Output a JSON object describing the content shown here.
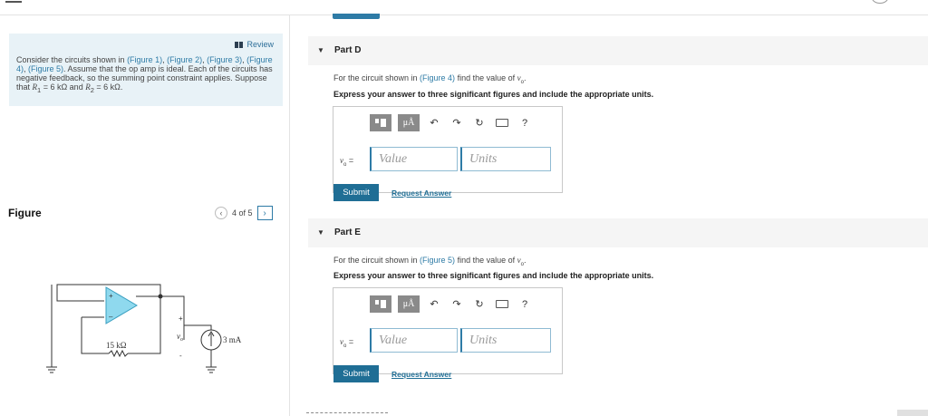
{
  "review_label": "Review",
  "intro": {
    "t1": "Consider the circuits shown in ",
    "f1": "(Figure 1)",
    "t2": ", ",
    "f2": "(Figure 2)",
    "t3": ", ",
    "f3": "(Figure 3)",
    "t4": ", ",
    "f4": "(Figure 4)",
    "t5": ", ",
    "f5": "(Figure 5)",
    "t6": ". Assume that the op amp is ideal. Each of the circuits has negative feedback, so the summing point constraint applies. Suppose that ",
    "r1": "R",
    "r1_sub": "1",
    "t7": " = 6 kΩ and ",
    "r2": "R",
    "r2_sub": "2",
    "t8": " = 6 kΩ."
  },
  "figure": {
    "label": "Figure",
    "pager_text": "4 of 5",
    "prev_glyph": "‹",
    "next_glyph": "›",
    "resistor_label": "15 kΩ",
    "vo_label": "v",
    "vo_sub": "o",
    "plus": "+",
    "minus": "-",
    "current_label": "3 mA",
    "opamp_plus": "+",
    "opamp_minus": "–"
  },
  "parts": [
    {
      "title": "Part D",
      "q_pre": "For the circuit shown in ",
      "q_link": "(Figure 4)",
      "q_post": " find the value of ",
      "instruction": "Express your answer to three significant figures and include the appropriate units.",
      "var": "v",
      "var_sub": "o",
      "eq": " =",
      "value_placeholder": "Value",
      "units_placeholder": "Units",
      "submit": "Submit",
      "request": "Request Answer"
    },
    {
      "title": "Part E",
      "q_pre": "For the circuit shown in ",
      "q_link": "(Figure 5)",
      "q_post": " find the value of ",
      "instruction": "Express your answer to three significant figures and include the appropriate units.",
      "var": "v",
      "var_sub": "o",
      "eq": " =",
      "value_placeholder": "Value",
      "units_placeholder": "Units",
      "submit": "Submit",
      "request": "Request Answer"
    }
  ],
  "toolbar": {
    "mu_label": "μÅ",
    "undo": "↶",
    "redo": "↷",
    "reset": "↻",
    "help": "?"
  },
  "colors": {
    "accent": "#1f6e95",
    "link": "#2e7ba6",
    "intro_bg": "#e8f2f7",
    "opamp_fill": "#8fd9ee",
    "opamp_stroke": "#3a9fc0"
  }
}
